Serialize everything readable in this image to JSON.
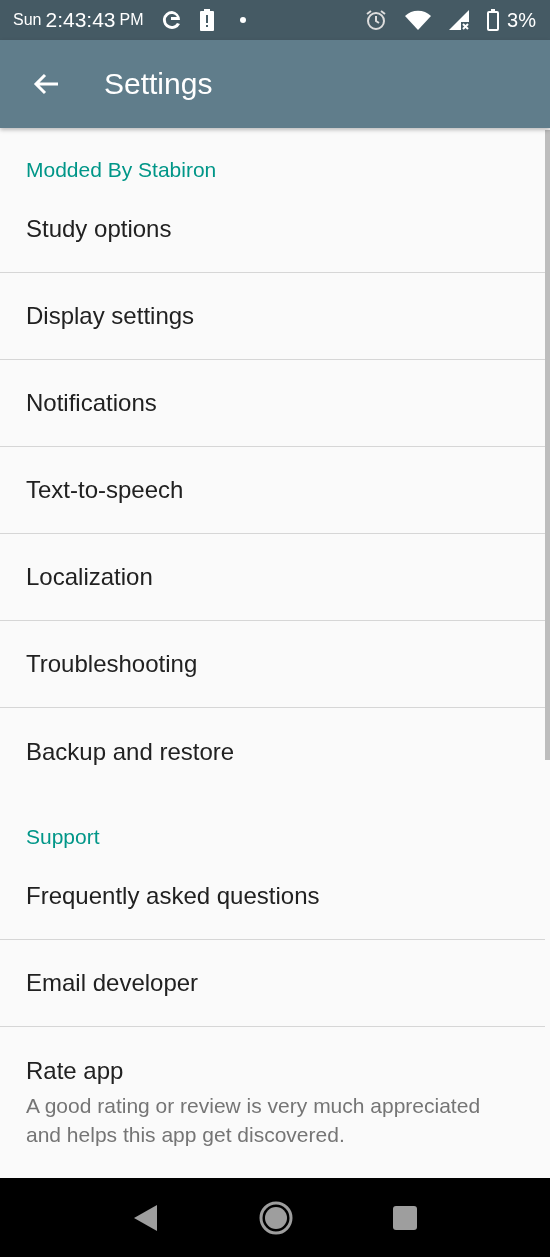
{
  "status_bar": {
    "day": "Sun",
    "time": "2:43:43",
    "meridiem": "PM",
    "battery_percent": "3%"
  },
  "app_bar": {
    "title": "Settings"
  },
  "sections": [
    {
      "title": "Modded By Stabiron",
      "items": [
        {
          "title": "Study options"
        },
        {
          "title": "Display settings"
        },
        {
          "title": "Notifications"
        },
        {
          "title": "Text-to-speech"
        },
        {
          "title": "Localization"
        },
        {
          "title": "Troubleshooting"
        },
        {
          "title": "Backup and restore"
        }
      ]
    },
    {
      "title": "Support",
      "items": [
        {
          "title": "Frequently asked questions"
        },
        {
          "title": "Email developer"
        },
        {
          "title": "Rate app",
          "summary": "A good rating or review is very much appreciated and helps this app get discovered."
        }
      ]
    }
  ]
}
